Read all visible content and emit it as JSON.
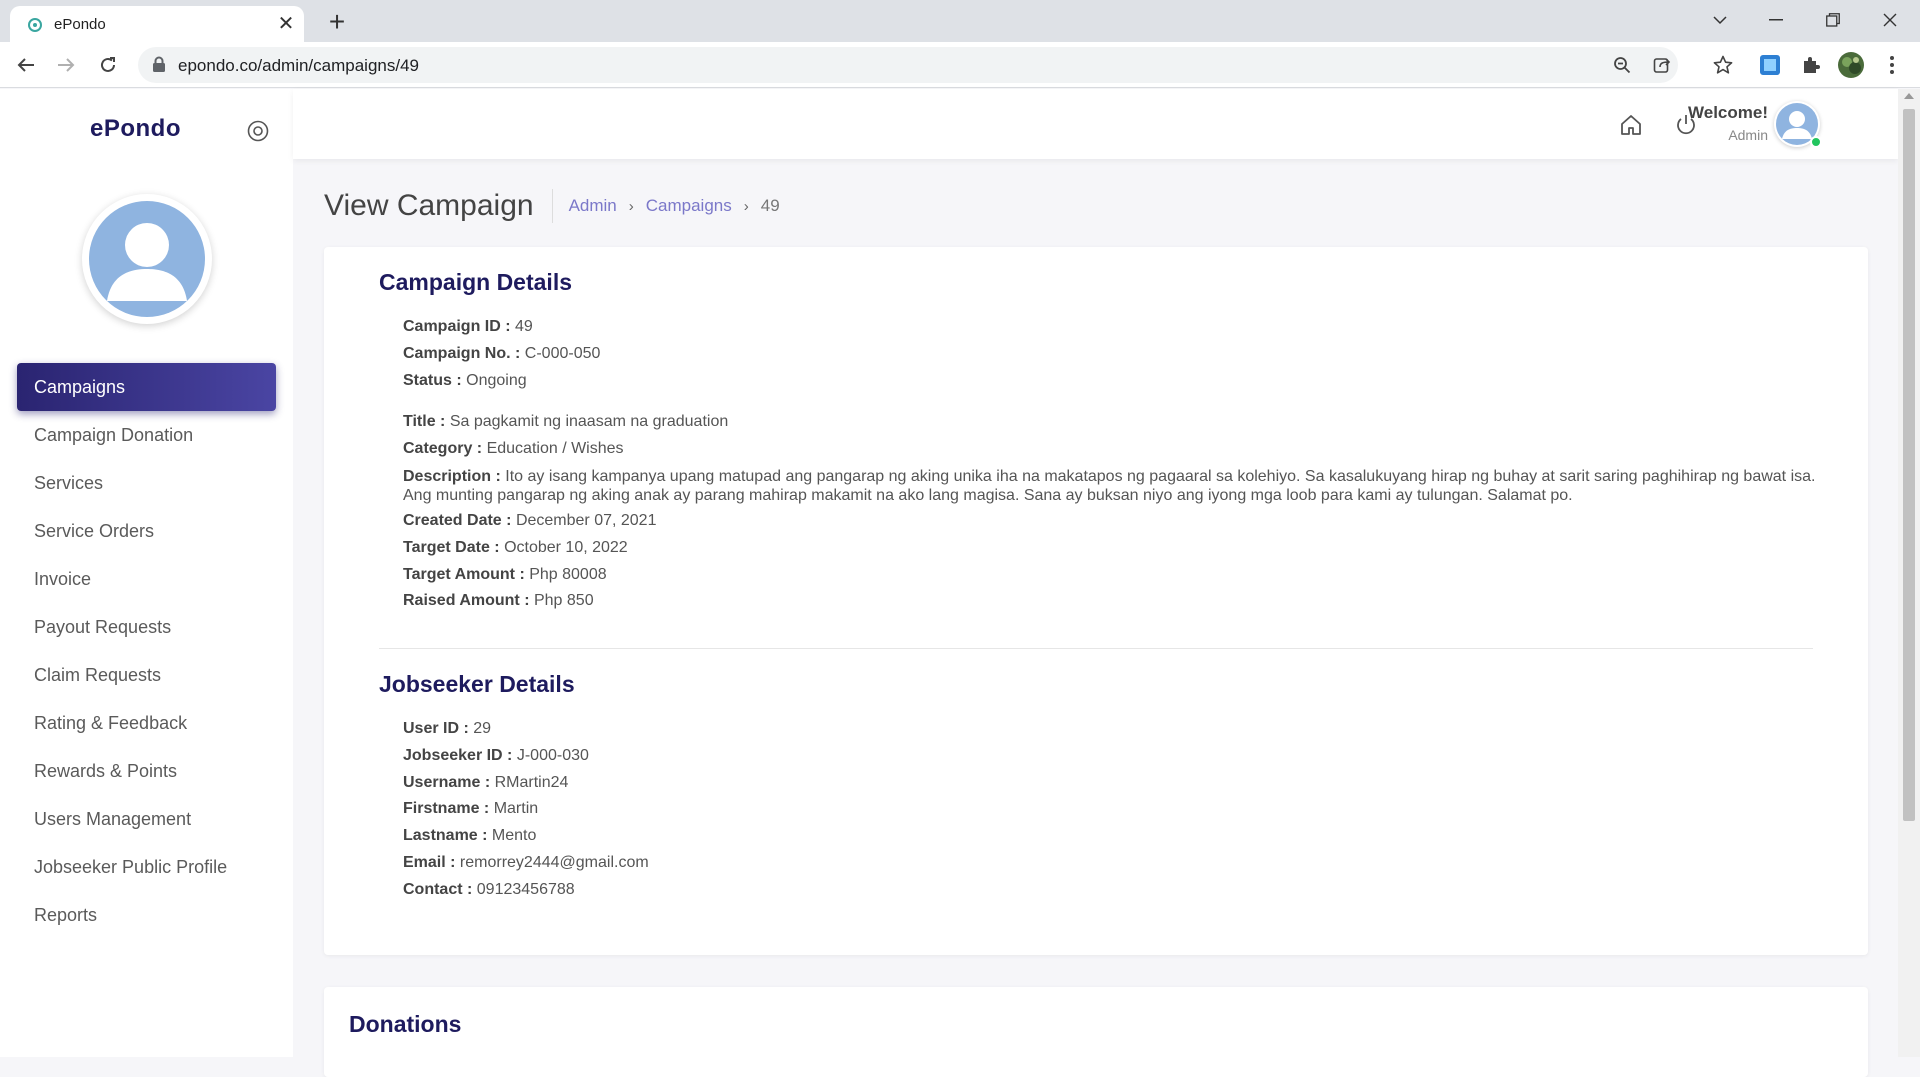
{
  "browser": {
    "tab_title": "ePondo",
    "url": "epondo.co/admin/campaigns/49",
    "close_glyph": "✕",
    "new_tab_glyph": "+"
  },
  "sidebar": {
    "brand": "ePondo",
    "items": [
      {
        "label": "Campaigns",
        "active": true
      },
      {
        "label": "Campaign Donation"
      },
      {
        "label": "Services"
      },
      {
        "label": "Service Orders"
      },
      {
        "label": "Invoice"
      },
      {
        "label": "Payout Requests"
      },
      {
        "label": "Claim Requests"
      },
      {
        "label": "Rating & Feedback"
      },
      {
        "label": "Rewards & Points"
      },
      {
        "label": "Users Management"
      },
      {
        "label": "Jobseeker Public Profile"
      },
      {
        "label": "Reports"
      }
    ]
  },
  "topbar": {
    "welcome": "Welcome!",
    "role": "Admin",
    "icons": [
      "home-icon",
      "power-icon"
    ]
  },
  "page": {
    "title": "View Campaign",
    "breadcrumb": [
      "Admin",
      "Campaigns",
      "49"
    ]
  },
  "campaign": {
    "section_title": "Campaign Details",
    "fields": [
      {
        "key": "Campaign ID :",
        "value": "49"
      },
      {
        "key": "Campaign No. :",
        "value": "C-000-050"
      },
      {
        "key": "Status :",
        "value": "Ongoing"
      },
      {
        "key": "Title :",
        "value": "Sa pagkamit ng inaasam na graduation"
      },
      {
        "key": "Category :",
        "value": "Education / Wishes"
      },
      {
        "key": "Description :",
        "value": "Ito ay isang kampanya upang matupad ang pangarap ng aking unika iha na makatapos ng pagaaral sa kolehiyo. Sa kasalukuyang hirap ng buhay at sarit saring paghihirap ng bawat isa. Ang munting pangarap ng aking anak ay parang mahirap makamit na ako lang magisa. Sana ay buksan niyo ang iyong mga loob para kami ay tulungan. Salamat po."
      },
      {
        "key": "Created Date :",
        "value": "December 07, 2021"
      },
      {
        "key": "Target Date :",
        "value": "October 10, 2022"
      },
      {
        "key": "Target Amount :",
        "value": "Php 80008"
      },
      {
        "key": "Raised Amount :",
        "value": "Php 850"
      }
    ]
  },
  "jobseeker": {
    "section_title": "Jobseeker Details",
    "fields": [
      {
        "key": "User ID :",
        "value": "29"
      },
      {
        "key": "Jobseeker ID :",
        "value": "J-000-030"
      },
      {
        "key": "Username :",
        "value": "RMartin24"
      },
      {
        "key": "Firstname :",
        "value": "Martin"
      },
      {
        "key": "Lastname :",
        "value": "Mento"
      },
      {
        "key": "Email :",
        "value": "remorrey2444@gmail.com"
      },
      {
        "key": "Contact :",
        "value": "09123456788"
      }
    ]
  },
  "donations": {
    "section_title": "Donations"
  },
  "colors": {
    "brand": "#1e1b5e",
    "accent": "#2a2471",
    "link": "#7b78c9",
    "online": "#22c55e"
  }
}
